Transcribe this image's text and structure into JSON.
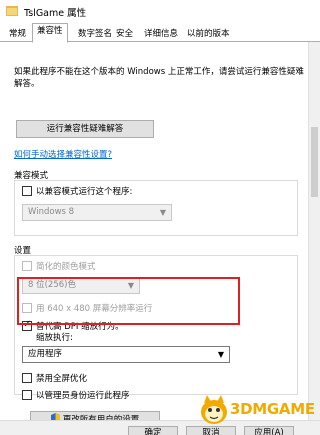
{
  "window": {
    "title": "TslGame 属性"
  },
  "tabs": [
    "常规",
    "兼容性",
    "数字签名",
    "安全",
    "详细信息",
    "以前的版本"
  ],
  "active_tab": "兼容性",
  "description": "如果此程序不能在这个版本的 Windows 上正常工作，请尝试运行兼容性疑难解答。",
  "troubleshooter_button": "运行兼容性疑难解答",
  "manual_link": "如何手动选择兼容性设置?",
  "compat_mode": {
    "title": "兼容模式",
    "checkbox_label": "以兼容模式运行这个程序:",
    "checked": false,
    "select_value": "Windows 8"
  },
  "settings": {
    "title": "设置",
    "reduced_color": {
      "label": "简化的颜色模式",
      "checked": false
    },
    "color_select_value": "8 位(256)色",
    "resolution": {
      "label": "用 640 x 480 屏幕分辨率运行",
      "checked": false
    },
    "dpi_override": {
      "label": "替代高 DPI 缩放行为。",
      "sublabel": "缩放执行:",
      "checked": true
    },
    "dpi_select_value": "应用程序",
    "fullscreen_opt": {
      "label": "禁用全屏优化",
      "checked": false
    },
    "run_as_admin": {
      "label": "以管理员身份运行此程序",
      "checked": false
    }
  },
  "change_all_button": "更改所有用户的设置",
  "bottom_buttons": [
    "确定",
    "取消",
    "应用(A)"
  ],
  "watermark": {
    "text": "3DMGAME"
  },
  "colors": {
    "highlight": "#e02020",
    "link": "#0066cc",
    "watermark": "#f2a900"
  }
}
